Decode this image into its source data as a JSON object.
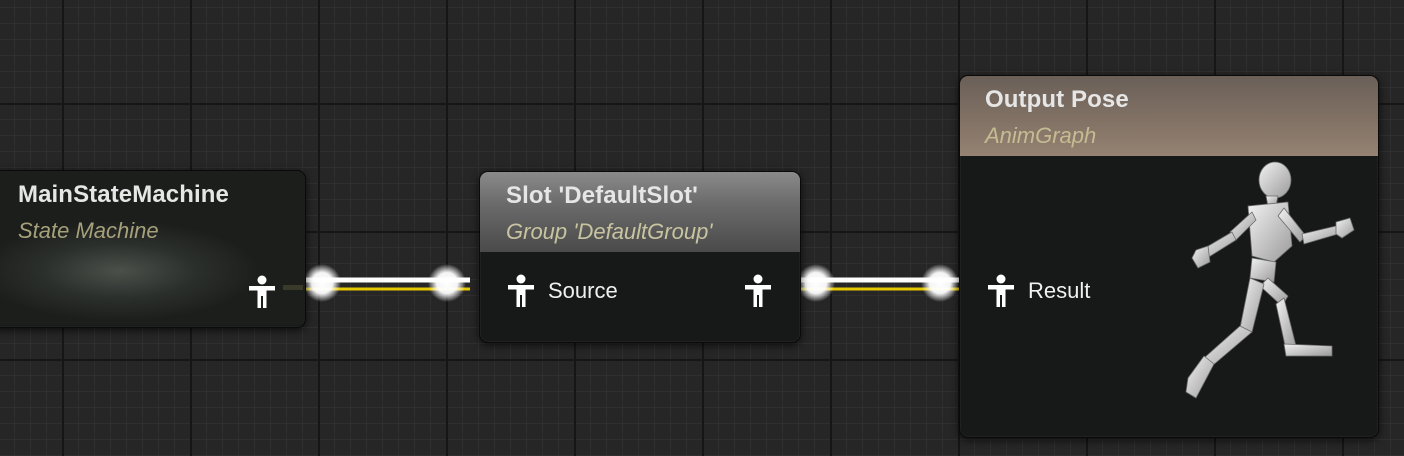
{
  "graph": {
    "nodes": [
      {
        "id": "main_state_machine",
        "title": "MainStateMachine",
        "subtitle": "State Machine",
        "output_pin": ""
      },
      {
        "id": "slot_default",
        "title": "Slot 'DefaultSlot'",
        "subtitle": "Group 'DefaultGroup'",
        "input_pin": "Source"
      },
      {
        "id": "output_pose",
        "title": "Output Pose",
        "subtitle": "AnimGraph",
        "input_pin": "Result",
        "preview_icon": "running-mannequin-icon"
      }
    ],
    "connections": [
      {
        "from": "main_state_machine",
        "to": "slot_default",
        "pin": "Source"
      },
      {
        "from": "slot_default",
        "to": "output_pose",
        "pin": "Result"
      }
    ]
  },
  "colors": {
    "wire": "#ffffff",
    "wire_highlight": "#e6c800",
    "subtitle": "#a6a17a",
    "output_pose_header": "#8c7868"
  },
  "icons": {
    "pose_pin": "pose-pin-icon",
    "preview": "running-mannequin-icon"
  }
}
